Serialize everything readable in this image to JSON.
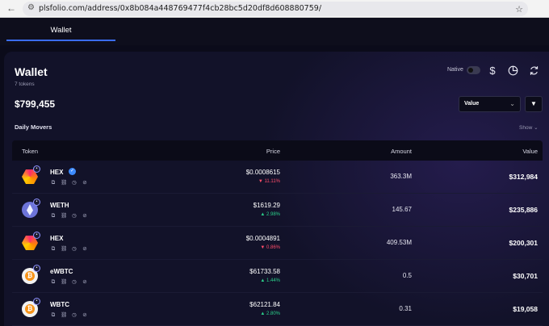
{
  "browser": {
    "url": "plsfolio.com/address/0x8b084a448769477f4cb28bc5d20df8d608880759/"
  },
  "tabs": [
    {
      "label": "Wallet"
    }
  ],
  "wallet": {
    "title": "Wallet",
    "token_count": "7 tokens",
    "total": "$799,455",
    "native_label": "Native",
    "dollar_glyph": "$",
    "sort_value": "Value",
    "daily_movers": "Daily Movers",
    "show_label": "Show ⌄"
  },
  "table": {
    "headers": {
      "token": "Token",
      "price": "Price",
      "amount": "Amount",
      "value": "Value"
    },
    "rows": [
      {
        "symbol": "HEX",
        "logo": "hex-logo-icon",
        "verified": true,
        "price": "$0.0008615",
        "change": "▼ 11.11%",
        "direction": "down",
        "amount": "363.3M",
        "value": "$312,984"
      },
      {
        "symbol": "WETH",
        "logo": "eth-logo-icon",
        "verified": false,
        "price": "$1619.29",
        "change": "▲ 2.98%",
        "direction": "up",
        "amount": "145.67",
        "value": "$235,886"
      },
      {
        "symbol": "HEX",
        "logo": "hex-logo-icon",
        "verified": false,
        "price": "$0.0004891",
        "change": "▼ 0.86%",
        "direction": "down",
        "amount": "409.53M",
        "value": "$200,301"
      },
      {
        "symbol": "eWBTC",
        "logo": "btc-logo-icon",
        "verified": false,
        "price": "$61733.58",
        "change": "▲ 1.44%",
        "direction": "up",
        "amount": "0.5",
        "value": "$30,701"
      },
      {
        "symbol": "WBTC",
        "logo": "btc-logo-icon",
        "verified": false,
        "price": "$62121.84",
        "change": "▲ 2.80%",
        "direction": "up",
        "amount": "0.31",
        "value": "$19,058"
      }
    ]
  },
  "colors": {
    "accent": "#3a6cf0",
    "down": "#ff4d6a",
    "up": "#2bd08a",
    "background": "#0b0b1a"
  }
}
